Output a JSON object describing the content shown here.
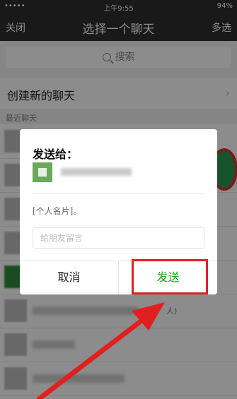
{
  "status_bar": {
    "carrier": "•••••",
    "time": "上午9:55",
    "battery": "94%"
  },
  "header": {
    "close_label": "关闭",
    "title": "选择一个聊天",
    "multi_select_label": "多选"
  },
  "search": {
    "placeholder": "搜索"
  },
  "new_chat": {
    "label": "创建新的聊天",
    "chevron": "›"
  },
  "section": {
    "recent_label": "最近聊天"
  },
  "list": {
    "partial_text": "人)"
  },
  "dialog": {
    "title": "发送给：",
    "card_text": "[个人名片]。",
    "message_placeholder": "给朋友留言",
    "cancel_label": "取消",
    "send_label": "发送"
  },
  "colors": {
    "accent_green": "#1aad19",
    "highlight_red": "#e02020",
    "nav_bg": "#2e2e2e"
  }
}
